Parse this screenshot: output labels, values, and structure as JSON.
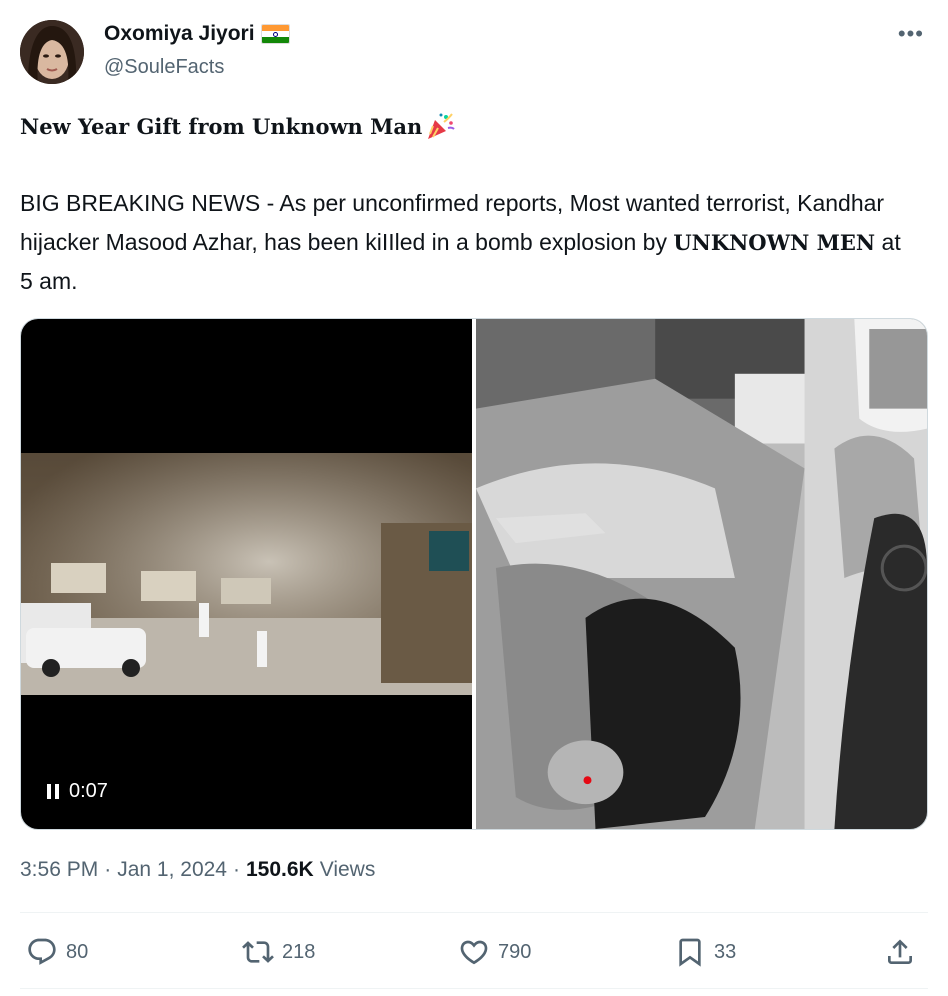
{
  "author": {
    "display_name": "Oxomiya Jiyori",
    "handle": "@SouleFacts",
    "flag_icon": "india-flag-icon"
  },
  "post": {
    "headline": "New Year Gift from Unknown Man",
    "headline_emoji": "party-popper-icon",
    "body_prefix": "BIG BREAKING NEWS - As per unconfirmed reports, Most wanted terrorist, Kandhar hijacker Masood Azhar, has been kiIIled in a bomb explosion by ",
    "body_bold": "UNKNOWN MEN",
    "body_suffix": " at 5 am."
  },
  "media": {
    "video_time": "0:07"
  },
  "meta": {
    "time": "3:56 PM",
    "date": "Jan 1, 2024",
    "views_count": "150.6K",
    "views_label": "Views",
    "separator": "·"
  },
  "actions": {
    "replies": "80",
    "reposts": "218",
    "likes": "790",
    "bookmarks": "33"
  },
  "colors": {
    "text_primary": "#0f1419",
    "text_secondary": "#536471",
    "divider": "#eff3f4"
  }
}
